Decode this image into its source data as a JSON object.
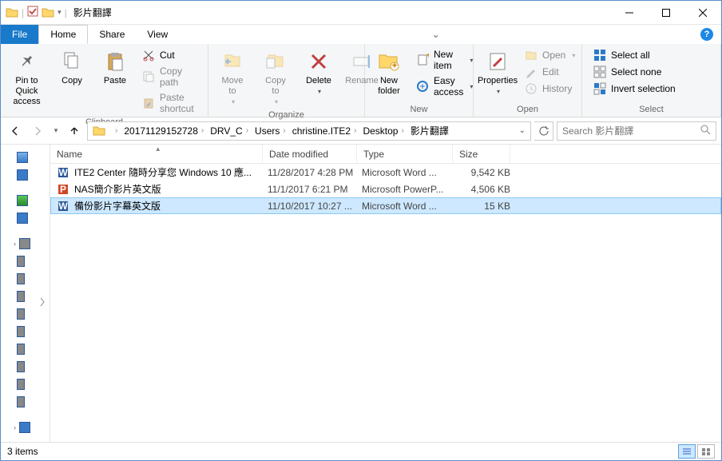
{
  "window": {
    "title": "影片翻譯"
  },
  "tabs": {
    "file": "File",
    "home": "Home",
    "share": "Share",
    "view": "View"
  },
  "ribbon": {
    "clipboard": {
      "label": "Clipboard",
      "pin": "Pin to Quick\naccess",
      "copy": "Copy",
      "paste": "Paste",
      "cut": "Cut",
      "copypath": "Copy path",
      "shortcut": "Paste shortcut"
    },
    "organize": {
      "label": "Organize",
      "moveto": "Move\nto",
      "copyto": "Copy\nto",
      "delete": "Delete",
      "rename": "Rename"
    },
    "new": {
      "label": "New",
      "newfolder": "New\nfolder",
      "newitem": "New item",
      "easyaccess": "Easy access"
    },
    "open": {
      "label": "Open",
      "properties": "Properties",
      "open": "Open",
      "edit": "Edit",
      "history": "History"
    },
    "select": {
      "label": "Select",
      "all": "Select all",
      "none": "Select none",
      "invert": "Invert selection"
    }
  },
  "breadcrumbs": [
    "20171129152728",
    "DRV_C",
    "Users",
    "christine.ITE2",
    "Desktop",
    "影片翻譯"
  ],
  "search": {
    "placeholder": "Search 影片翻譯"
  },
  "columns": {
    "name": "Name",
    "date": "Date modified",
    "type": "Type",
    "size": "Size"
  },
  "files": [
    {
      "icon": "word",
      "name": "ITE2 Center 隨時分享您 Windows 10 應...",
      "date": "11/28/2017 4:28 PM",
      "type": "Microsoft Word ...",
      "size": "9,542 KB"
    },
    {
      "icon": "ppt",
      "name": "NAS簡介影片英文版",
      "date": "11/1/2017 6:21 PM",
      "type": "Microsoft PowerP...",
      "size": "4,506 KB"
    },
    {
      "icon": "word",
      "name": "備份影片字幕英文版",
      "date": "11/10/2017 10:27 ...",
      "type": "Microsoft Word ...",
      "size": "15 KB"
    }
  ],
  "status": {
    "items": "3 items"
  }
}
